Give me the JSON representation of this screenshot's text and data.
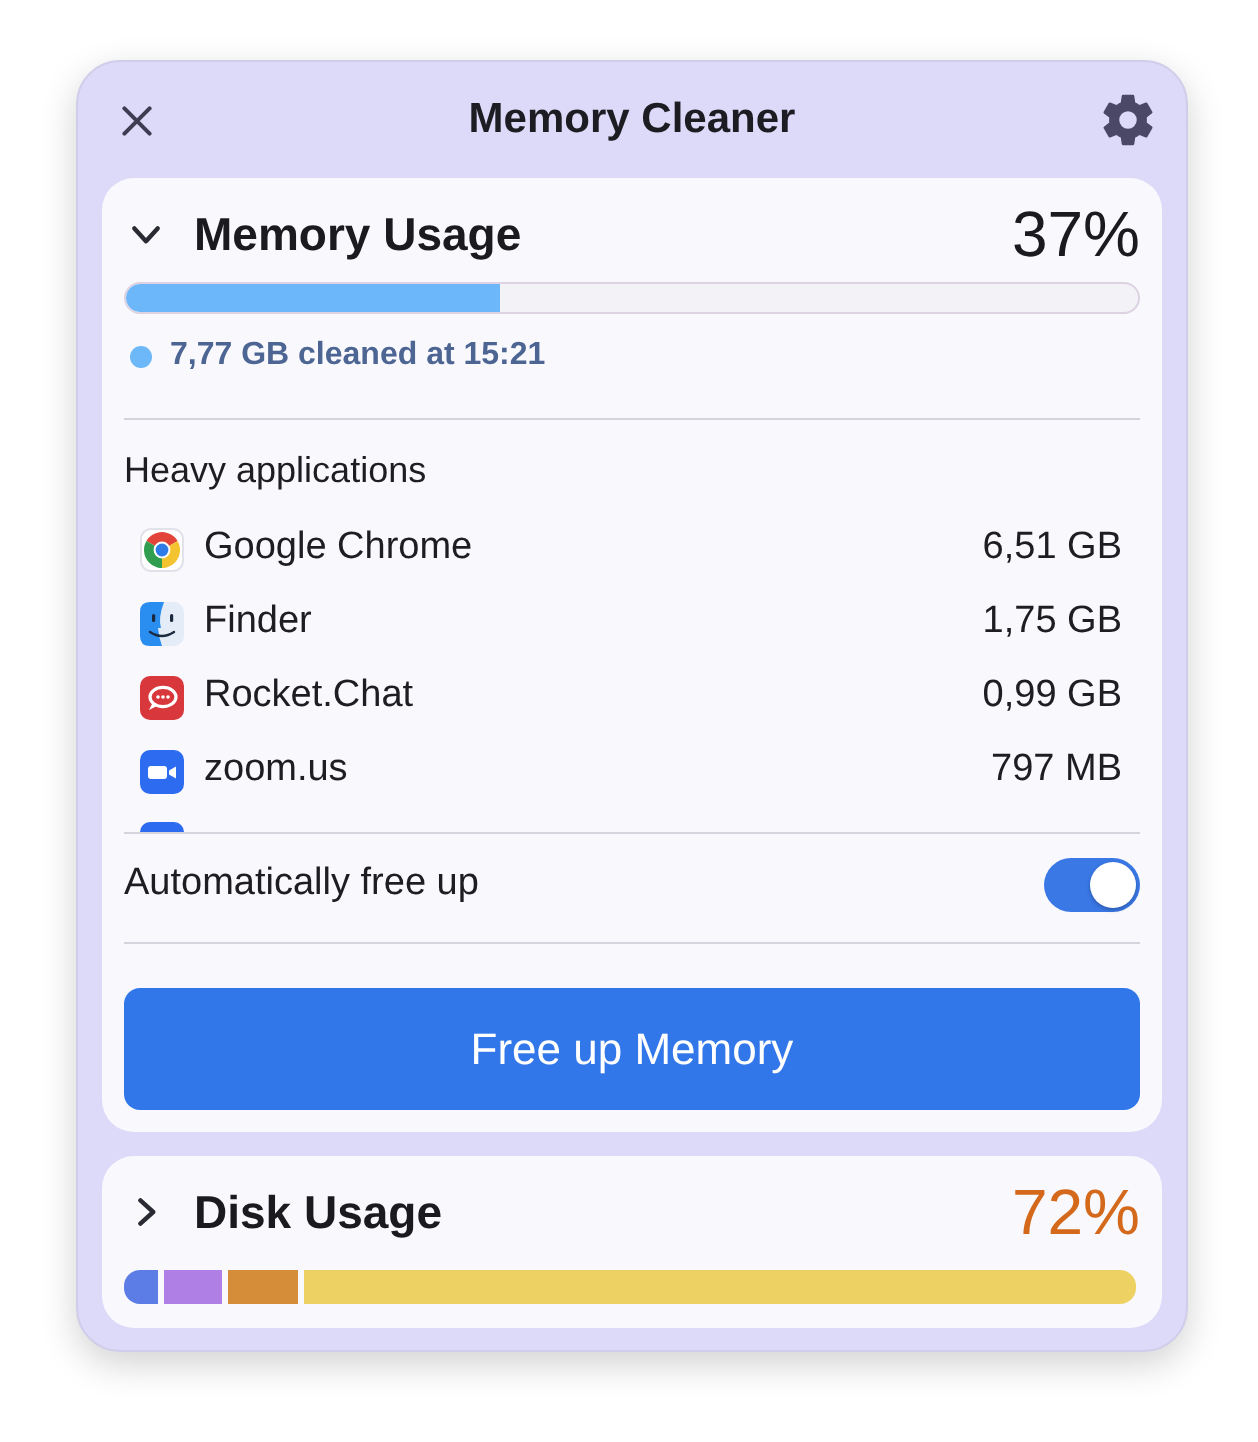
{
  "window": {
    "title": "Memory Cleaner"
  },
  "memory": {
    "title": "Memory Usage",
    "expanded": true,
    "percent": "37%",
    "level": 0.37,
    "status": "7,77 GB cleaned at 15:21"
  },
  "heavy_applications": {
    "title": "Heavy applications",
    "items": [
      {
        "kind": "chrome",
        "name": "Google Chrome",
        "size": "6,51 GB"
      },
      {
        "kind": "finder",
        "name": "Finder",
        "size": "1,75 GB"
      },
      {
        "kind": "rocketchat",
        "name": "Rocket.Chat",
        "size": "0,99 GB"
      },
      {
        "kind": "zoom",
        "name": "zoom.us",
        "size": "797 MB"
      }
    ]
  },
  "auto_free": {
    "label": "Automatically free up",
    "on": true
  },
  "action_button": "Free up Memory",
  "disk": {
    "title": "Disk Usage",
    "expanded": false,
    "percent": "72%",
    "segments": [
      {
        "color": "#5c7ce6",
        "level": 0.034
      },
      {
        "color": "#b07fe6",
        "level": 0.057
      },
      {
        "color": "#d68d3a",
        "level": 0.068
      },
      {
        "color": "#edd263",
        "level": 0.82
      }
    ]
  }
}
